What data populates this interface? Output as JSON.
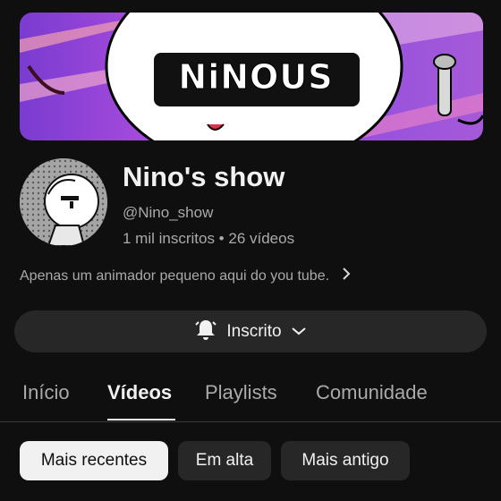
{
  "banner": {
    "title": "NiNOUS"
  },
  "channel": {
    "name": "Nino's show",
    "handle": "@Nino_show",
    "meta": "1 mil inscritos • 26 vídeos",
    "description": "Apenas um animador pequeno aqui do you tube."
  },
  "subscribe": {
    "label": "Inscrito",
    "bell_icon": "bell-icon",
    "chevron_icon": "chevron-down-icon"
  },
  "tabs": [
    {
      "label": "Início",
      "active": false
    },
    {
      "label": "Vídeos",
      "active": true
    },
    {
      "label": "Playlists",
      "active": false
    },
    {
      "label": "Comunidade",
      "active": false
    }
  ],
  "filters": [
    {
      "label": "Mais recentes",
      "active": true
    },
    {
      "label": "Em alta",
      "active": false
    },
    {
      "label": "Mais antigo",
      "active": false
    }
  ],
  "colors": {
    "background": "#0f0f0f",
    "surface": "#272727",
    "text": "#f1f1f1",
    "muted": "#aaaaaa"
  }
}
